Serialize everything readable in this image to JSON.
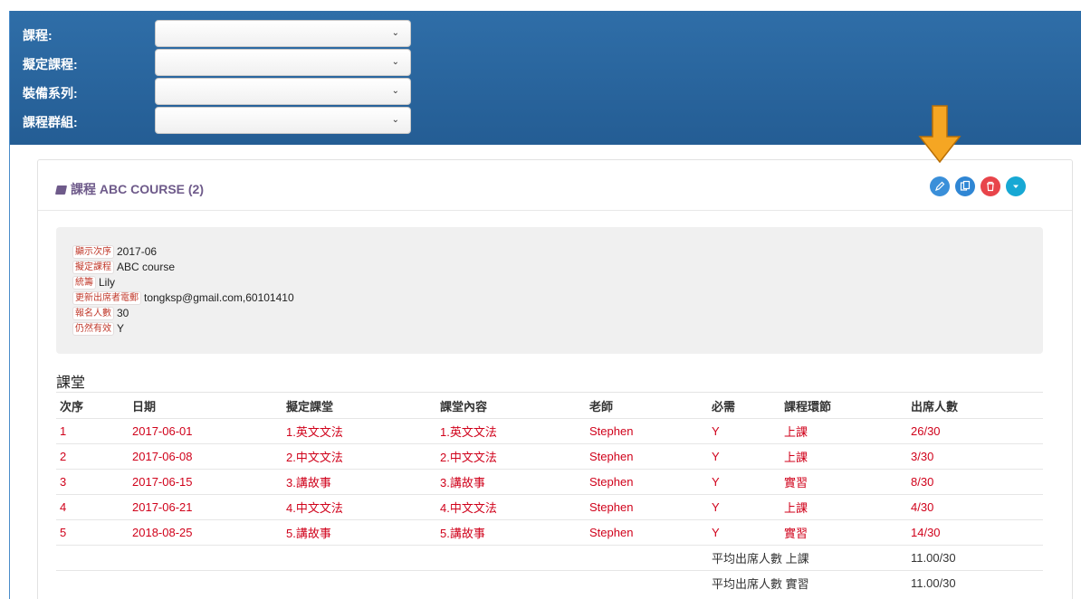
{
  "filters": [
    {
      "label": "課程:",
      "value": ""
    },
    {
      "label": "擬定課程:",
      "value": ""
    },
    {
      "label": "裝備系列:",
      "value": ""
    },
    {
      "label": "課程群組:",
      "value": ""
    }
  ],
  "panel": {
    "title": "課程 ABC COURSE (2)",
    "actions": {
      "edit": "edit-icon",
      "copy": "copy-icon",
      "delete": "trash-icon",
      "more": "caret-down-icon"
    }
  },
  "info": [
    {
      "label": "顯示次序",
      "value": "2017-06"
    },
    {
      "label": "擬定課程",
      "value": "ABC course"
    },
    {
      "label": "統籌",
      "value": "Lily"
    },
    {
      "label": "更新出席者電郵",
      "value": "tongksp@gmail.com,60101410"
    },
    {
      "label": "報名人數",
      "value": "30"
    },
    {
      "label": "仍然有效",
      "value": "Y"
    }
  ],
  "lessons": {
    "title": "課堂",
    "headers": [
      "次序",
      "日期",
      "擬定課堂",
      "課堂內容",
      "老師",
      "必需",
      "課程環節",
      "出席人數"
    ],
    "rows": [
      [
        "1",
        "2017-06-01",
        "1.英文文法",
        "1.英文文法",
        "Stephen",
        "Y",
        "上課",
        "26/30"
      ],
      [
        "2",
        "2017-06-08",
        "2.中文文法",
        "2.中文文法",
        "Stephen",
        "Y",
        "上課",
        "3/30"
      ],
      [
        "3",
        "2017-06-15",
        "3.講故事",
        "3.講故事",
        "Stephen",
        "Y",
        "實習",
        "8/30"
      ],
      [
        "4",
        "2017-06-21",
        "4.中文文法",
        "4.中文文法",
        "Stephen",
        "Y",
        "上課",
        "4/30"
      ],
      [
        "5",
        "2018-08-25",
        "5.講故事",
        "5.講故事",
        "Stephen",
        "Y",
        "實習",
        "14/30"
      ]
    ],
    "summary": [
      {
        "label": "平均出席人數",
        "type": "上課",
        "value": "11.00/30"
      },
      {
        "label": "平均出席人數",
        "type": "實習",
        "value": "11.00/30"
      }
    ]
  },
  "colors": {
    "header_bg": "#2f6ea8",
    "accent_red": "#d0021b",
    "title_purple": "#6e5a8a",
    "arrow": "#f5a623"
  }
}
